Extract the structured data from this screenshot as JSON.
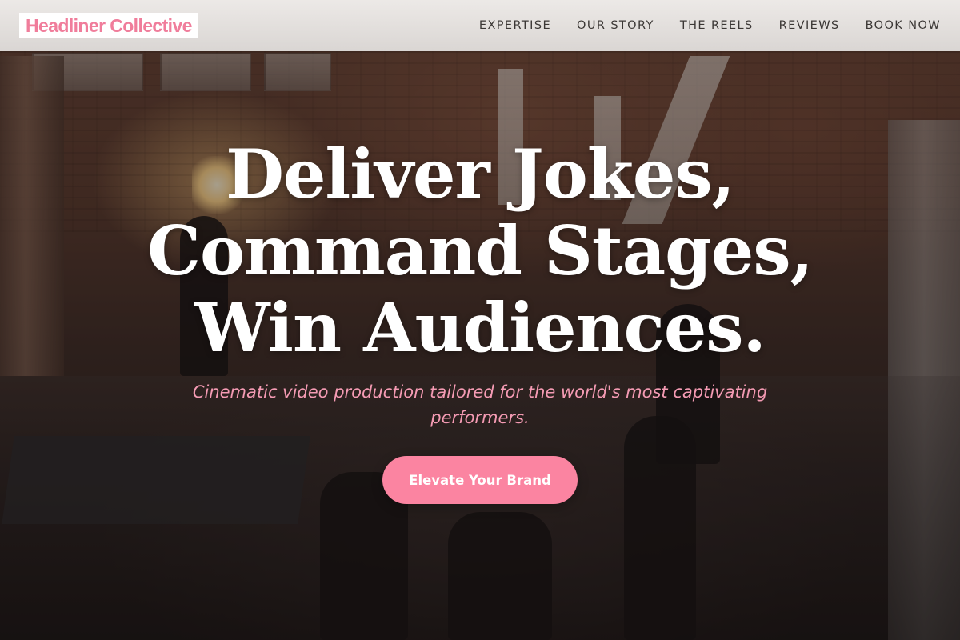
{
  "brand": {
    "name": "Headliner Collective",
    "accent_color": "#f07d9b",
    "button_color": "#fb84a1"
  },
  "nav": {
    "items": [
      {
        "label": "EXPERTISE"
      },
      {
        "label": "OUR STORY"
      },
      {
        "label": "THE REELS"
      },
      {
        "label": "REVIEWS"
      },
      {
        "label": "BOOK NOW"
      }
    ]
  },
  "hero": {
    "headline_lines": [
      "Deliver Jokes,",
      "Command Stages,",
      "Win Audiences."
    ],
    "subheadline": "Cinematic video production tailored for the world's most captivating performers.",
    "cta_label": "Elevate Your Brand",
    "background_image": "film-set-photo"
  }
}
